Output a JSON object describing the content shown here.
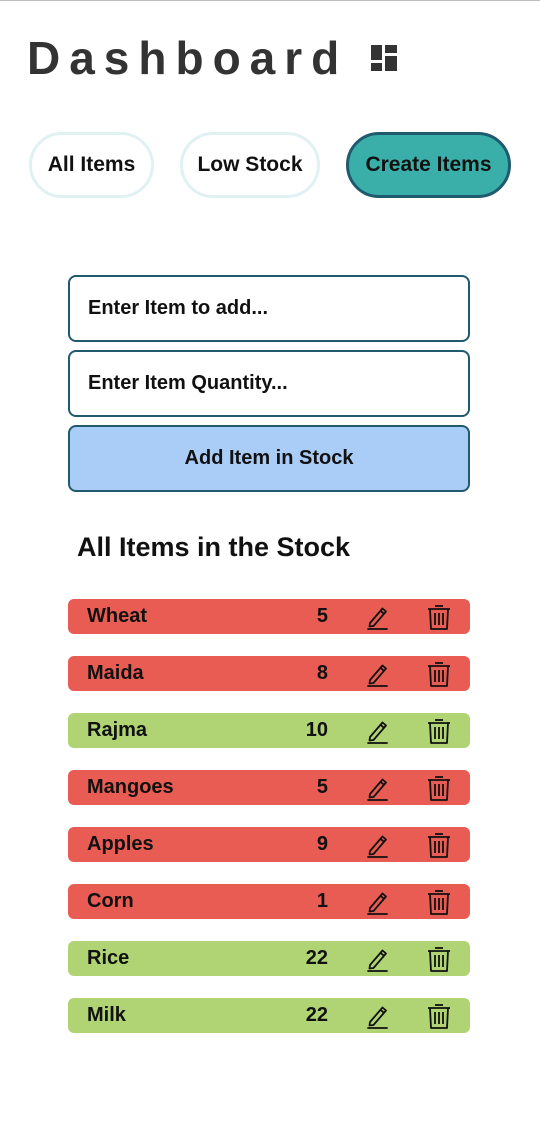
{
  "header": {
    "title": "Dashboard",
    "icon": "dashboard-icon"
  },
  "tabs": [
    {
      "label": "All Items"
    },
    {
      "label": "Low Stock"
    },
    {
      "label": "Create Items",
      "active": true
    }
  ],
  "form": {
    "item_placeholder": "Enter Item to add...",
    "quantity_placeholder": "Enter Item Quantity...",
    "add_label": "Add Item in Stock"
  },
  "stock": {
    "title": "All Items in the Stock",
    "items": [
      {
        "name": "Wheat",
        "qty": "5",
        "status": "low"
      },
      {
        "name": "Maida",
        "qty": "8",
        "status": "low"
      },
      {
        "name": "Rajma",
        "qty": "10",
        "status": "ok"
      },
      {
        "name": "Mangoes",
        "qty": "5",
        "status": "low"
      },
      {
        "name": "Apples",
        "qty": "9",
        "status": "low"
      },
      {
        "name": "Corn",
        "qty": "1",
        "status": "low"
      },
      {
        "name": "Rice",
        "qty": "22",
        "status": "ok"
      },
      {
        "name": "Milk",
        "qty": "22",
        "status": "ok"
      }
    ],
    "edit_icon": "pencil-icon",
    "delete_icon": "trash-icon"
  },
  "colors": {
    "low": "#e85c53",
    "ok": "#b0d474",
    "accent": "#3aafa9",
    "border": "#1f5a6f",
    "button": "#aacdf7"
  }
}
